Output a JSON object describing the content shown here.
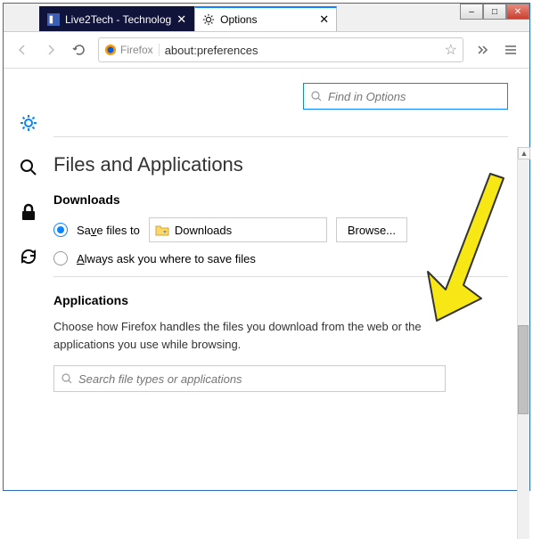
{
  "window": {
    "minimize": "–",
    "maximize": "□",
    "close": "✕"
  },
  "tabs": [
    {
      "title": "Live2Tech - Technolog",
      "active": false
    },
    {
      "title": "Options",
      "active": true
    }
  ],
  "nav": {
    "identity": "Firefox",
    "url": "about:preferences"
  },
  "find": {
    "placeholder": "Find in Options"
  },
  "section": {
    "title": "Files and Applications"
  },
  "downloads": {
    "heading": "Downloads",
    "save_label_pre": "Sa",
    "save_label_u": "v",
    "save_label_post": "e files to",
    "folder": "Downloads",
    "browse": "Browse...",
    "always_pre": "",
    "always_u": "A",
    "always_post": "lways ask you where to save files"
  },
  "applications": {
    "heading": "Applications",
    "desc": "Choose how Firefox handles the files you download from the web or the applications you use while browsing.",
    "search_placeholder": "Search file types or applications"
  }
}
